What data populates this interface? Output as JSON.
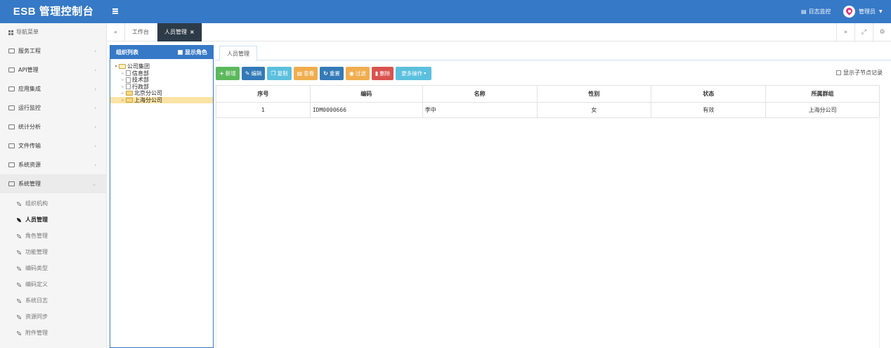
{
  "app": {
    "title": "ESB 管理控制台"
  },
  "header": {
    "log_label": "日志监控",
    "user_label": "管理员",
    "accent_color": "#3679c6"
  },
  "sidebar": {
    "nav_title": "导航菜单",
    "items": [
      {
        "label": "服务工程"
      },
      {
        "label": "API管理"
      },
      {
        "label": "应用集成"
      },
      {
        "label": "运行监控"
      },
      {
        "label": "统计分析"
      },
      {
        "label": "文件传输"
      },
      {
        "label": "系统资源"
      },
      {
        "label": "系统管理"
      }
    ],
    "sub_items": [
      {
        "label": "组织机构"
      },
      {
        "label": "人员管理"
      },
      {
        "label": "角色管理"
      },
      {
        "label": "功能管理"
      },
      {
        "label": "编码类型"
      },
      {
        "label": "编码定义"
      },
      {
        "label": "系统日志"
      },
      {
        "label": "资源同步"
      },
      {
        "label": "附件管理"
      }
    ]
  },
  "tabs": [
    {
      "label": "工作台"
    },
    {
      "label": "人员管理",
      "close": "×"
    }
  ],
  "org_panel": {
    "title": "组织列表",
    "show_roles_label": "显示角色",
    "tree": [
      {
        "label": "公司集团"
      },
      {
        "label": "信息部"
      },
      {
        "label": "技术部"
      },
      {
        "label": "行政部"
      },
      {
        "label": "北京分公司"
      },
      {
        "label": "上海分公司"
      }
    ]
  },
  "main": {
    "subtab_label": "人员管理",
    "toolbar": [
      {
        "label": "新增",
        "icon": "+",
        "color": "#5cb85c"
      },
      {
        "label": "编辑",
        "icon": "✎",
        "color": "#337ab7"
      },
      {
        "label": "复制",
        "icon": "❐",
        "color": "#5bc0de"
      },
      {
        "label": "查看",
        "icon": "▤",
        "color": "#f0ad4e"
      },
      {
        "label": "重置",
        "icon": "↻",
        "color": "#337ab7"
      },
      {
        "label": "过滤",
        "icon": "◉",
        "color": "#f0ad4e"
      },
      {
        "label": "删除",
        "icon": "▮",
        "color": "#d9534f"
      },
      {
        "label": "更多操作",
        "icon": "▾",
        "color": "#5bc0de"
      }
    ],
    "show_child_records_label": "显示子节点记录",
    "table": {
      "headers": [
        "序号",
        "编码",
        "名称",
        "性别",
        "状态",
        "所属群组"
      ],
      "rows": [
        [
          "1",
          "IDM0000666",
          "李中",
          "女",
          "有效",
          "上海分公司"
        ]
      ]
    }
  }
}
